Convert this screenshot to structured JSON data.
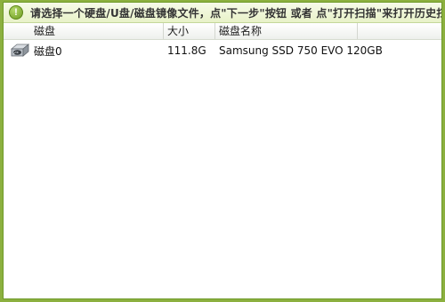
{
  "banner": {
    "icon": "exclamation-icon",
    "text": "请选择一个硬盘/U盘/磁盘镜像文件，点\"下一步\"按钮 或者 点\"打开扫描\"来打开历史扫"
  },
  "table": {
    "columns": [
      "磁盘",
      "大小",
      "磁盘名称"
    ],
    "rows": [
      {
        "icon": "hard-disk-icon",
        "disk": "磁盘0",
        "size": "111.8G",
        "name": "Samsung SSD 750 EVO 120GB"
      }
    ]
  },
  "colors": {
    "frame": "#8cb03f",
    "banner_bg": "#eef5d8"
  }
}
